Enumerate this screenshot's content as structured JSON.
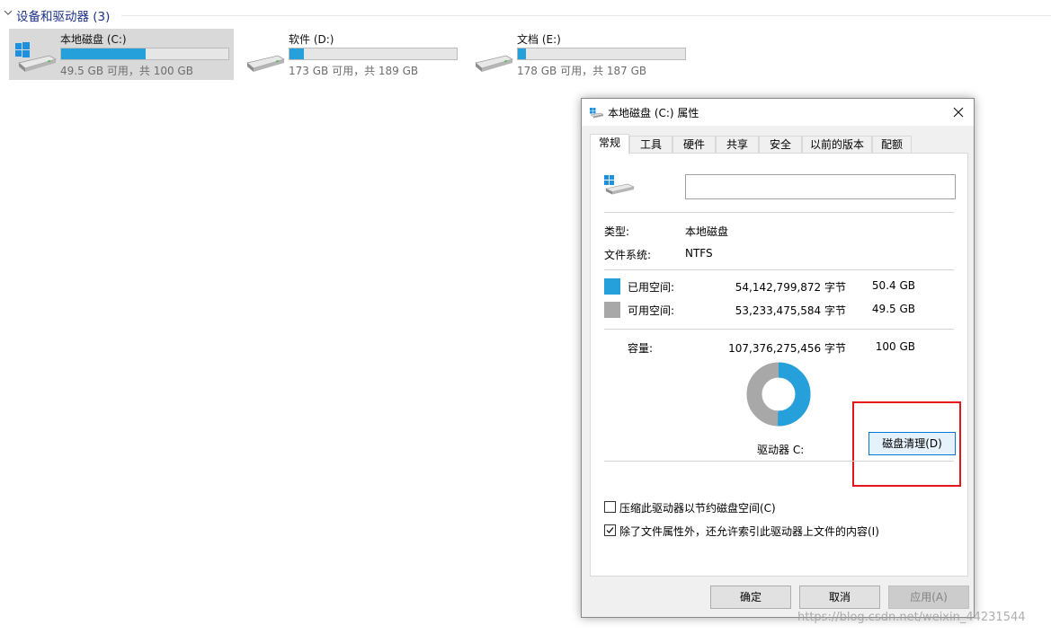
{
  "explorer": {
    "group_title": "设备和驱动器 (3)",
    "drives": [
      {
        "name": "本地磁盘 (C:)",
        "free_text": "49.5 GB 可用，共 100 GB",
        "used_fraction": 0.505,
        "selected": true,
        "icon": "windows-drive-icon"
      },
      {
        "name": "软件 (D:)",
        "free_text": "173 GB 可用，共 189 GB",
        "used_fraction": 0.085,
        "selected": false,
        "icon": "drive-icon"
      },
      {
        "name": "文档 (E:)",
        "free_text": "178 GB 可用，共 187 GB",
        "used_fraction": 0.05,
        "selected": false,
        "icon": "drive-icon"
      }
    ]
  },
  "dialog": {
    "title": "本地磁盘 (C:) 属性",
    "tabs": [
      "常规",
      "工具",
      "硬件",
      "共享",
      "安全",
      "以前的版本",
      "配额"
    ],
    "active_tab": "常规",
    "name_value": "",
    "type_label": "类型:",
    "type_value": "本地磁盘",
    "fs_label": "文件系统:",
    "fs_value": "NTFS",
    "used": {
      "label": "已用空间:",
      "bytes": "54,142,799,872 字节",
      "size": "50.4 GB",
      "color": "#26a0da"
    },
    "free": {
      "label": "可用空间:",
      "bytes": "53,233,475,584 字节",
      "size": "49.5 GB",
      "color": "#a8a8a8"
    },
    "capacity": {
      "label": "容量:",
      "bytes": "107,376,275,456 字节",
      "size": "100 GB"
    },
    "used_fraction": 0.504,
    "drive_label": "驱动器 C:",
    "cleanup_button": "磁盘清理(D)",
    "compress_label": "压缩此驱动器以节约磁盘空间(C)",
    "compress_checked": false,
    "index_label": "除了文件属性外，还允许索引此驱动器上文件的内容(I)",
    "index_checked": true,
    "ok_button": "确定",
    "cancel_button": "取消",
    "apply_button": "应用(A)",
    "annotation_color": "#e3171b"
  },
  "watermark": "https://blog.csdn.net/weixin_44231544"
}
